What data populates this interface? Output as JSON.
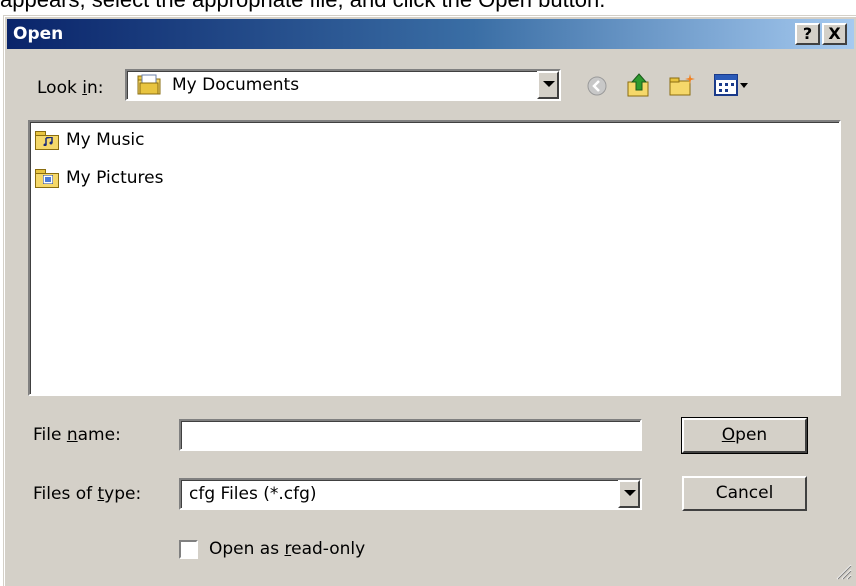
{
  "instruction_text": "appears, select the appropriate file, and click the Open button.",
  "dialog": {
    "title": "Open",
    "help_label": "?",
    "close_label": "X"
  },
  "look_in": {
    "label_pre": "Look ",
    "label_hotkey": "i",
    "label_post": "n:",
    "value": "My Documents"
  },
  "files": [
    {
      "name": "My Music",
      "icon": "music-folder-icon"
    },
    {
      "name": "My Pictures",
      "icon": "pictures-folder-icon"
    }
  ],
  "file_name": {
    "label_pre": "File ",
    "label_hotkey": "n",
    "label_post": "ame:",
    "value": ""
  },
  "file_type": {
    "label_pre": "Files of ",
    "label_hotkey": "t",
    "label_post": "ype:",
    "value": "cfg Files (*.cfg)"
  },
  "buttons": {
    "open_hotkey": "O",
    "open_rest": "pen",
    "cancel": "Cancel"
  },
  "readonly": {
    "label_pre": "Open as ",
    "label_hotkey": "r",
    "label_post": "ead-only",
    "checked": false
  },
  "colors": {
    "titlebar_start": "#0a246a",
    "titlebar_end": "#a6caf0",
    "face": "#d4d0c8"
  }
}
